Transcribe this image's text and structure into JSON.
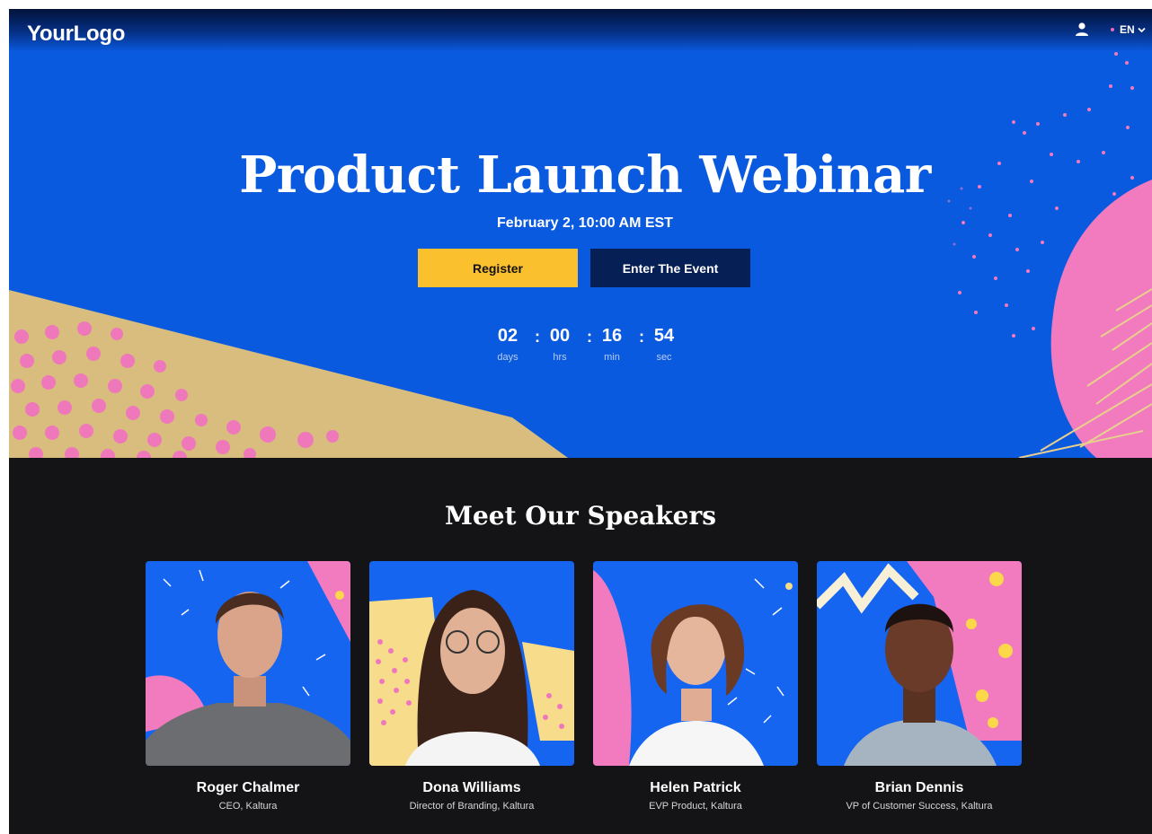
{
  "header": {
    "logo": "YourLogo",
    "language": "EN",
    "user_icon": "user-icon",
    "language_icon": "chevron-down-icon"
  },
  "hero": {
    "title": "Product Launch Webinar",
    "date": "February 2, 10:00 AM  EST",
    "register_label": "Register",
    "enter_label": "Enter The Event",
    "countdown": [
      {
        "value": "02",
        "label": "days"
      },
      {
        "value": "00",
        "label": "hrs"
      },
      {
        "value": "16",
        "label": "min"
      },
      {
        "value": "54",
        "label": "sec"
      }
    ],
    "separator": ":"
  },
  "speakers": {
    "title": "Meet Our Speakers",
    "items": [
      {
        "name": "Roger Chalmer",
        "role": "CEO, Kaltura"
      },
      {
        "name": "Dona Williams",
        "role": "Director of Branding, Kaltura"
      },
      {
        "name": "Helen Patrick",
        "role": "EVP Product, Kaltura"
      },
      {
        "name": "Brian Dennis",
        "role": "VP of Customer Success, Kaltura"
      }
    ]
  },
  "colors": {
    "hero_blue": "#0a5ae0",
    "register_yellow": "#fbc02d",
    "enter_navy": "#061f55",
    "page_dark": "#141416",
    "accent_pink": "#f27bbf",
    "accent_tan": "#d8bd7e"
  }
}
